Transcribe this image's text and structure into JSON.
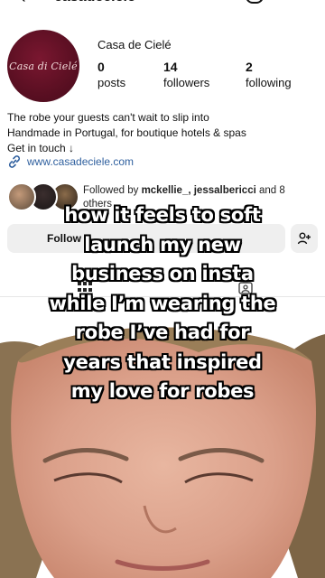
{
  "header": {
    "handle": "casadeciele",
    "back_icon": "back-arrow-icon",
    "notif_icon": "bell-icon"
  },
  "profile": {
    "avatar_logo_text": "Casa di Cielé",
    "name": "Casa de Cielé",
    "stats": [
      {
        "num": "0",
        "label": "posts"
      },
      {
        "num": "14",
        "label": "followers"
      },
      {
        "num": "2",
        "label": "following"
      }
    ],
    "bio_lines": [
      "The robe your guests can't wait to slip into",
      "Handmade in Portugal, for boutique hotels & spas",
      "Get in touch ↓"
    ],
    "link": "www.casadeciele.com"
  },
  "followed_by": {
    "prefix": "Followed by ",
    "names": "mckellie_, jessalbericci",
    "suffix": " and 8 others"
  },
  "actions": {
    "follow_label": "Follow",
    "add_person_icon": "add-person-icon"
  },
  "caption_lines": [
    "how it feels to soft",
    "launch my new",
    "business on insta",
    "while I’m wearing the",
    "robe I’ve had for",
    "years that inspired",
    "my love for robes"
  ],
  "colors": {
    "avatar_bg": "#5a0f22",
    "link": "#2e5f9e",
    "button_bg": "#efefef"
  }
}
